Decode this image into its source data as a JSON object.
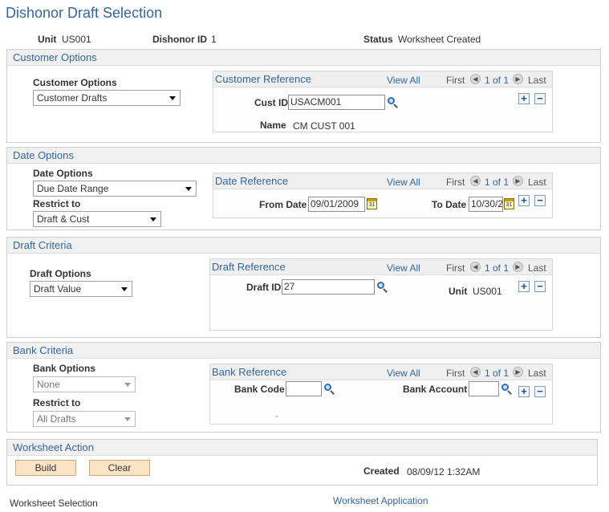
{
  "page": {
    "title": "Dishonor Draft Selection"
  },
  "header": {
    "unit_label": "Unit",
    "unit_value": "US001",
    "dishonor_id_label": "Dishonor ID",
    "dishonor_id_value": "1",
    "status_label": "Status",
    "status_value": "Worksheet Created"
  },
  "grid_nav": {
    "view_all": "View All",
    "first": "First",
    "count": "1 of 1",
    "last": "Last"
  },
  "customer_options": {
    "section_title": "Customer Options",
    "field_label": "Customer Options",
    "selected": "Customer Drafts",
    "grid_title": "Customer Reference",
    "cust_id_label": "Cust ID",
    "cust_id_value": "USACM001",
    "name_label": "Name",
    "name_value": "CM CUST 001"
  },
  "date_options": {
    "section_title": "Date Options",
    "field_label": "Date Options",
    "selected": "Due Date Range",
    "restrict_label": "Restrict to",
    "restrict_selected": "Draft & Cust",
    "grid_title": "Date Reference",
    "from_label": "From Date",
    "from_value": "09/01/2009",
    "to_label": "To Date",
    "to_value": "10/30/2",
    "cal_text": "31"
  },
  "draft_criteria": {
    "section_title": "Draft Criteria",
    "field_label": "Draft Options",
    "selected": "Draft Value",
    "grid_title": "Draft Reference",
    "draft_id_label": "Draft ID",
    "draft_id_value": "27",
    "unit_label": "Unit",
    "unit_value": "US001"
  },
  "bank_criteria": {
    "section_title": "Bank Criteria",
    "field_label": "Bank Options",
    "selected": "None",
    "restrict_label": "Restrict to",
    "restrict_selected": "All Drafts",
    "grid_title": "Bank Reference",
    "bank_code_label": "Bank Code",
    "bank_code_value": "",
    "bank_account_label": "Bank Account",
    "bank_account_value": "",
    "dash": "-"
  },
  "worksheet_action": {
    "section_title": "Worksheet Action",
    "build_label": "Build",
    "clear_label": "Clear",
    "created_label": "Created",
    "created_value": "08/09/12  1:32AM"
  },
  "footer": {
    "worksheet_selection": "Worksheet Selection",
    "worksheet_application": "Worksheet Application"
  },
  "colors": {
    "accent": "#336699",
    "button_bg": "#fbe3c6",
    "section_head_bg": "#f0f0f0"
  }
}
